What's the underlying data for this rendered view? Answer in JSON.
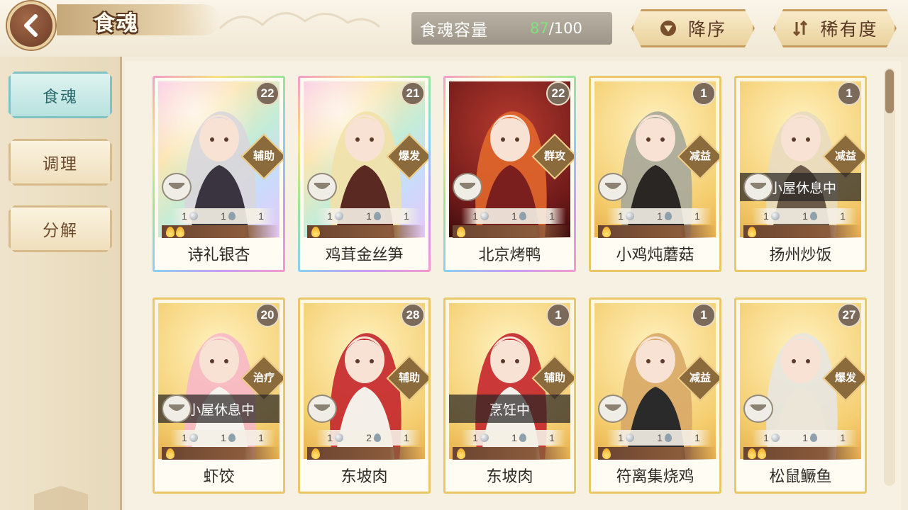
{
  "header": {
    "title": "食魂",
    "capacity_label": "食魂容量",
    "capacity_current": "87",
    "capacity_max": "/100",
    "sort_order_label": "降序",
    "sort_type_label": "稀有度"
  },
  "sidebar": {
    "items": [
      {
        "label": "食魂",
        "active": true
      },
      {
        "label": "调理",
        "active": false
      },
      {
        "label": "分解",
        "active": false
      }
    ]
  },
  "cards": [
    {
      "name": "诗礼银杏",
      "level": "22",
      "role": "辅助",
      "status": "",
      "stats": [
        "1",
        "1",
        "1"
      ],
      "flames": 2,
      "frame": "rainbow"
    },
    {
      "name": "鸡茸金丝笋",
      "level": "21",
      "role": "爆发",
      "status": "",
      "stats": [
        "1",
        "1",
        "1"
      ],
      "flames": 1,
      "frame": "rainbow"
    },
    {
      "name": "北京烤鸭",
      "level": "22",
      "role": "群攻",
      "status": "",
      "stats": [
        "1",
        "1",
        "1"
      ],
      "flames": 1,
      "frame": "rainbow"
    },
    {
      "name": "小鸡炖蘑菇",
      "level": "1",
      "role": "减益",
      "status": "",
      "stats": [
        "1",
        "1",
        "1"
      ],
      "flames": 1,
      "frame": "gold"
    },
    {
      "name": "扬州炒饭",
      "level": "1",
      "role": "减益",
      "status": "小屋休息中",
      "stats": [
        "1",
        "1",
        "1"
      ],
      "flames": 1,
      "frame": "gold"
    },
    {
      "name": "虾饺",
      "level": "20",
      "role": "治疗",
      "status": "小屋休息中",
      "stats": [
        "1",
        "1",
        "1"
      ],
      "flames": 1,
      "frame": "gold"
    },
    {
      "name": "东坡肉",
      "level": "28",
      "role": "辅助",
      "status": "",
      "stats": [
        "1",
        "2",
        "1"
      ],
      "flames": 1,
      "frame": "gold"
    },
    {
      "name": "东坡肉",
      "level": "1",
      "role": "辅助",
      "status": "烹饪中",
      "stats": [
        "1",
        "1",
        "1"
      ],
      "flames": 1,
      "frame": "gold"
    },
    {
      "name": "符离集烧鸡",
      "level": "1",
      "role": "减益",
      "status": "",
      "stats": [
        "1",
        "1",
        "1"
      ],
      "flames": 1,
      "frame": "gold"
    },
    {
      "name": "松鼠鳜鱼",
      "level": "27",
      "role": "爆发",
      "status": "",
      "stats": [
        "1",
        "1",
        "1"
      ],
      "flames": 2,
      "frame": "gold"
    }
  ],
  "colors": {
    "accent_teal": "#7ec3c2",
    "frame_gold": "#eac86a",
    "capacity_current": "#7fe37d",
    "title_brown": "#5e3a22"
  }
}
